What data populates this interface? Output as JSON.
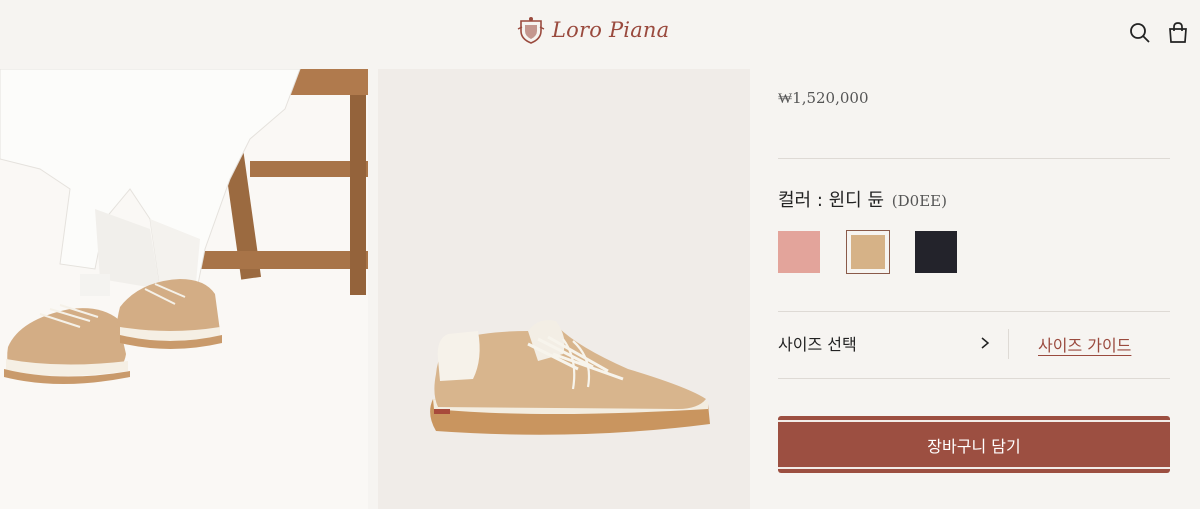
{
  "brand": {
    "name": "Loro Piana"
  },
  "header": {
    "icons": [
      "search-icon",
      "shopping-bag-icon"
    ]
  },
  "product": {
    "price": "₩1,520,000",
    "color_label": "컬러 : 윈디 듄",
    "color_code": "(D0EE)",
    "swatches": [
      {
        "name": "pink",
        "color": "#e3a49b"
      },
      {
        "name": "sand",
        "color": "#d6b287",
        "selected": true
      },
      {
        "name": "navy",
        "color": "#23232b"
      }
    ],
    "size_select_label": "사이즈 선택",
    "size_guide_label": "사이즈 가이드",
    "add_to_cart_label": "장바구니 담기"
  },
  "colors": {
    "accent": "#9c4f41",
    "background": "#f6f4f1"
  }
}
